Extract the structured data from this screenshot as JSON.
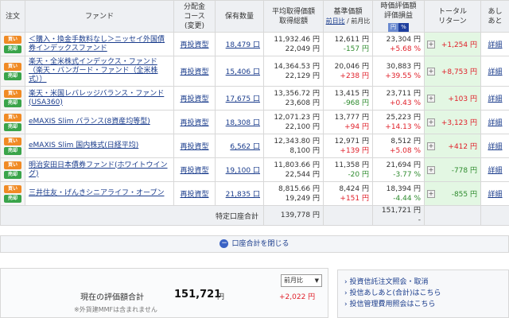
{
  "headers": {
    "order": "注文",
    "fund": "ファンド",
    "dist1": "分配金",
    "dist2": "コース",
    "dist3": "(変更)",
    "qty": "保有数量",
    "avg1": "平均取得価額",
    "avg2": "取得総額",
    "base1": "基準価額",
    "base2a": "前日比",
    "base2b": "前月比",
    "eval1": "時価評価額",
    "eval2": "評価損益",
    "toggle_yen": "円",
    "toggle_pct": "%",
    "ret1": "トータル",
    "ret2": "リターン",
    "after1": "あし",
    "after2": "あと"
  },
  "buy_label": "買い",
  "sell_label": "売却",
  "detail_label": "詳細",
  "funds": [
    {
      "name": "＜購入・換金手数料なし＞ニッセイ外国債券インデックスファンド",
      "dist": "再投資型",
      "qty": "18,479 口",
      "avg": "11,932.46 円",
      "cost": "22,049 円",
      "base": "12,611 円",
      "base_chg": "-157 円",
      "value": "23,304 円",
      "value_chg": "+5.68 %",
      "ret": "+1,254 円"
    },
    {
      "name": "楽天・全米株式インデックス・ファンド（楽天・バンガード・ファンド（全米株式））",
      "dist": "再投資型",
      "qty": "15,406 口",
      "avg": "14,364.53 円",
      "cost": "22,129 円",
      "base": "20,046 円",
      "base_chg": "+238 円",
      "value": "30,883 円",
      "value_chg": "+39.55 %",
      "ret": "+8,753 円"
    },
    {
      "name": "楽天・米国レバレッジバランス・ファンド(USA360)",
      "dist": "再投資型",
      "qty": "17,675 口",
      "avg": "13,356.72 円",
      "cost": "23,608 円",
      "base": "13,415 円",
      "base_chg": "-968 円",
      "value": "23,711 円",
      "value_chg": "+0.43 %",
      "ret": "+103 円"
    },
    {
      "name": "eMAXIS Slim バランス(8資産均等型)",
      "dist": "再投資型",
      "qty": "18,308 口",
      "avg": "12,071.23 円",
      "cost": "22,100 円",
      "base": "13,777 円",
      "base_chg": "+94 円",
      "value": "25,223 円",
      "value_chg": "+14.13 %",
      "ret": "+3,123 円"
    },
    {
      "name": "eMAXIS Slim 国内株式(日経平均)",
      "dist": "再投資型",
      "qty": "6,562 口",
      "avg": "12,343.80 円",
      "cost": "8,100 円",
      "base": "12,971 円",
      "base_chg": "+139 円",
      "value": "8,512 円",
      "value_chg": "+5.08 %",
      "ret": "+412 円"
    },
    {
      "name": "明治安田日本債券ファンド(ホワイトウイング)",
      "dist": "再投資型",
      "qty": "19,100 口",
      "avg": "11,803.66 円",
      "cost": "22,544 円",
      "base": "11,358 円",
      "base_chg": "-20 円",
      "value": "21,694 円",
      "value_chg": "-3.77 %",
      "ret": "-778 円"
    },
    {
      "name": "三井住友・げんきシニアライフ・オープン",
      "dist": "再投資型",
      "qty": "21,835 口",
      "avg": "8,815.66 円",
      "cost": "19,249 円",
      "base": "8,424 円",
      "base_chg": "+151 円",
      "value": "18,394 円",
      "value_chg": "-4.44 %",
      "ret": "-855 円"
    }
  ],
  "total_row": {
    "label": "特定口座合計",
    "cost": "139,778 円",
    "value": "151,721 円",
    "dash": "-"
  },
  "close_label": "口座合計を閉じる",
  "summary": {
    "label": "現在の評価額合計",
    "value": "151,721",
    "unit": "円",
    "change": "+2,022 円",
    "select": "前月比",
    "note": "※外貨建MMFは含まれません"
  },
  "links": [
    "投資信託注文照会・取消",
    "投信あしあと(合計)はこちら",
    "投信管理費用照会はこちら"
  ],
  "colors": {
    "positive": "#e0202a",
    "negative": "#2e8b2e",
    "return_bg": "#e3f7e3",
    "link": "#1a3c8c"
  }
}
